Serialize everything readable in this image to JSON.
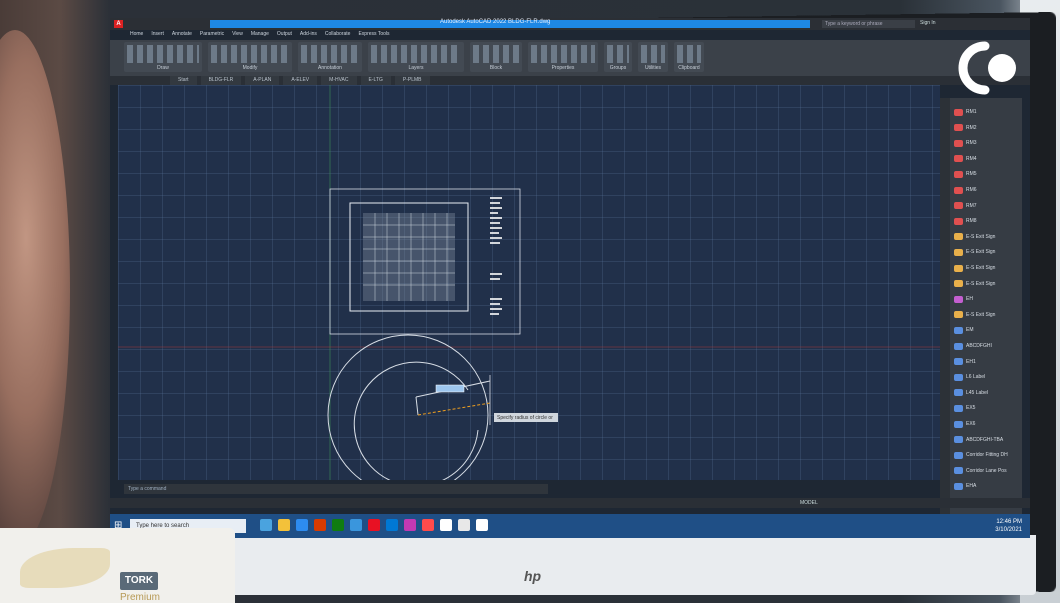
{
  "app": {
    "title": "Autodesk AutoCAD 2022  BLDG-FLR.dwg",
    "logo_letter": "A",
    "search_placeholder": "Type a keyword or phrase",
    "sign_in": "Sign In"
  },
  "menu_tabs": [
    "Home",
    "Insert",
    "Annotate",
    "Parametric",
    "View",
    "Manage",
    "Output",
    "Add-ins",
    "Collaborate",
    "Express Tools"
  ],
  "ribbon_panels": [
    {
      "label": "Draw"
    },
    {
      "label": "Modify"
    },
    {
      "label": "Annotation"
    },
    {
      "label": "Layers"
    },
    {
      "label": "Block"
    },
    {
      "label": "Properties"
    },
    {
      "label": "Groups"
    },
    {
      "label": "Utilities"
    },
    {
      "label": "Clipboard"
    }
  ],
  "doc_tabs": [
    "Start",
    "BLDG-FLR",
    "A-PLAN",
    "A-ELEV",
    "M-HVAC",
    "E-LTG",
    "P-PLMB"
  ],
  "command_line": "Type a command",
  "tooltip_text": "Specify radius of circle or",
  "palette_items": [
    {
      "label": "RM1",
      "color": "#e05050"
    },
    {
      "label": "RM2",
      "color": "#e05050"
    },
    {
      "label": "RM3",
      "color": "#e05050"
    },
    {
      "label": "RM4",
      "color": "#e05050"
    },
    {
      "label": "RM5",
      "color": "#e05050"
    },
    {
      "label": "RM6",
      "color": "#e05050"
    },
    {
      "label": "RM7",
      "color": "#e05050"
    },
    {
      "label": "RM8",
      "color": "#e05050"
    },
    {
      "label": "E-S Exit Sign",
      "color": "#e9b04b"
    },
    {
      "label": "E-S Exit Sign",
      "color": "#e9b04b"
    },
    {
      "label": "E-S Exit Sign",
      "color": "#e9b04b"
    },
    {
      "label": "E-S Exit Sign",
      "color": "#e9b04b"
    },
    {
      "label": "EH",
      "color": "#c45fd1"
    },
    {
      "label": "E-S Exit Sign",
      "color": "#e9b04b"
    },
    {
      "label": "EM",
      "color": "#5a8fe0"
    },
    {
      "label": "ABCDFGHI",
      "color": "#5a8fe0"
    },
    {
      "label": "EH1",
      "color": "#5a8fe0"
    },
    {
      "label": "L6 Label",
      "color": "#5a8fe0"
    },
    {
      "label": "L45 Label",
      "color": "#5a8fe0"
    },
    {
      "label": "EX5",
      "color": "#5a8fe0"
    },
    {
      "label": "EX6",
      "color": "#5a8fe0"
    },
    {
      "label": "ABCDFGHI-TBA",
      "color": "#5a8fe0"
    },
    {
      "label": "Corridor Fitting DH",
      "color": "#5a8fe0"
    },
    {
      "label": "Corridor Lane Pos",
      "color": "#5a8fe0"
    },
    {
      "label": "EHA",
      "color": "#5a8fe0"
    },
    {
      "label": "EHA-1",
      "color": "#5a8fe0"
    },
    {
      "label": "EHS",
      "color": "#5a8fe0"
    }
  ],
  "status_bar": {
    "model_label": "MODEL"
  },
  "taskbar": {
    "search_placeholder": "Type here to search",
    "icons": [
      "#4aa3df",
      "#f3c13a",
      "#2d8cf0",
      "#d83b01",
      "#107c10",
      "#3a96dd",
      "#e81123",
      "#0078d4",
      "#c239b3",
      "#ff4b4b",
      "#ffffff",
      "#e8e8e8",
      "#ffffff"
    ],
    "time": "12:46 PM",
    "date": "3/10/2021"
  },
  "tissue_box": {
    "brand": "TORK",
    "sub": "Premium"
  },
  "monitor_brand": "hp",
  "colors": {
    "canvas": "#21304a",
    "accent": "#1e88e5",
    "taskbar": "#1f4f86"
  }
}
